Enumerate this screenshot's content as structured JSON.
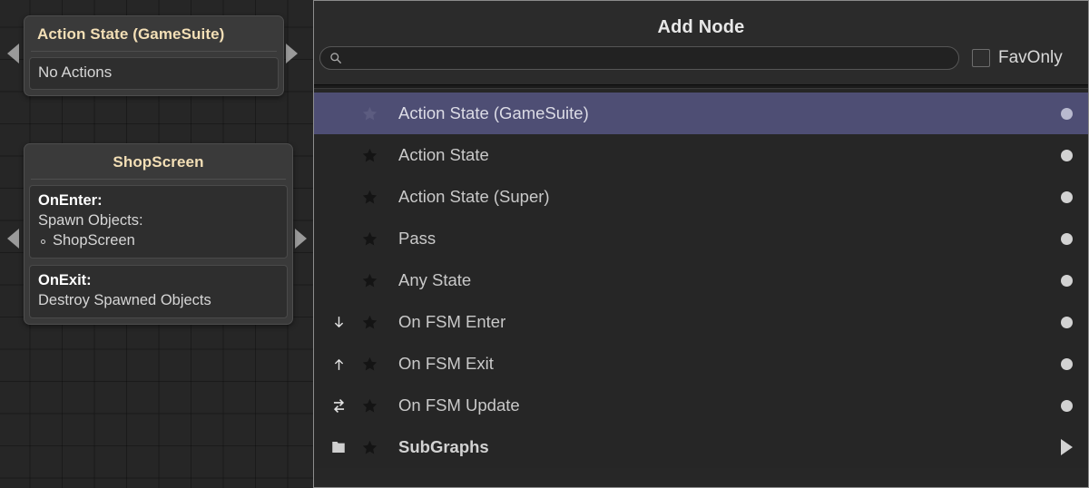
{
  "graph": {
    "nodes": [
      {
        "title": "Action State (GameSuite)",
        "title_align": "left",
        "sections": [
          {
            "lines": [
              {
                "text": "No Actions",
                "style": "normal"
              }
            ]
          }
        ],
        "ports": {
          "in": "input-port",
          "out": "output-port"
        }
      },
      {
        "title": "ShopScreen",
        "title_align": "center",
        "sections": [
          {
            "lines": [
              {
                "text": "OnEnter:",
                "style": "bold"
              },
              {
                "text": "Spawn Objects:",
                "style": "normal"
              },
              {
                "text": "ShopScreen",
                "style": "bullet"
              }
            ]
          },
          {
            "lines": [
              {
                "text": "OnExit:",
                "style": "bold"
              },
              {
                "text": "Destroy Spawned Objects",
                "style": "normal"
              }
            ]
          }
        ],
        "ports": {
          "in": "input-port",
          "out": "output-port"
        }
      }
    ]
  },
  "panel": {
    "title": "Add Node",
    "search": {
      "value": "",
      "placeholder": "",
      "icon": "search-icon"
    },
    "fav_only": {
      "label": "FavOnly",
      "checked": false
    },
    "rows": [
      {
        "label": "Action State (GameSuite)",
        "lead_icon": "",
        "star": "star-icon",
        "trail": "dot",
        "selected": true,
        "bold": false
      },
      {
        "label": "Action State",
        "lead_icon": "",
        "star": "star-icon",
        "trail": "dot",
        "selected": false,
        "bold": false
      },
      {
        "label": "Action State (Super)",
        "lead_icon": "",
        "star": "star-icon",
        "trail": "dot",
        "selected": false,
        "bold": false
      },
      {
        "label": "Pass",
        "lead_icon": "",
        "star": "star-icon",
        "trail": "dot",
        "selected": false,
        "bold": false
      },
      {
        "label": "Any State",
        "lead_icon": "",
        "star": "star-icon",
        "trail": "dot",
        "selected": false,
        "bold": false
      },
      {
        "label": "On FSM Enter",
        "lead_icon": "arrow-down-icon",
        "star": "star-icon",
        "trail": "dot",
        "selected": false,
        "bold": false
      },
      {
        "label": "On FSM Exit",
        "lead_icon": "arrow-up-icon",
        "star": "star-icon",
        "trail": "dot",
        "selected": false,
        "bold": false
      },
      {
        "label": "On FSM Update",
        "lead_icon": "refresh-icon",
        "star": "star-icon",
        "trail": "dot",
        "selected": false,
        "bold": false
      },
      {
        "label": "SubGraphs",
        "lead_icon": "folder-icon",
        "star": "star-icon",
        "trail": "triangle-right",
        "selected": false,
        "bold": true
      }
    ]
  },
  "colors": {
    "selection": "#4e4e74",
    "node_title": "#f3dfb6",
    "canvas": "#262626",
    "panel": "#272727",
    "dot": "#d2d2d2"
  }
}
